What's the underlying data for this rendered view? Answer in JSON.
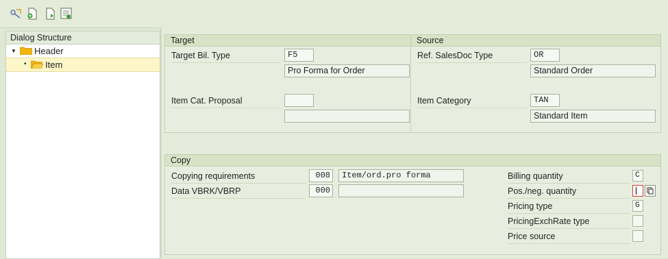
{
  "toolbar": {
    "buttons": [
      {
        "icon": "display-change-icon"
      },
      {
        "icon": "new-entries-icon"
      },
      {
        "icon": "copy-as-icon"
      },
      {
        "icon": "delimit-icon"
      }
    ]
  },
  "dialog_structure": {
    "title": "Dialog Structure",
    "items": [
      {
        "label": "Header",
        "expanded": true
      },
      {
        "label": "Item",
        "selected": true
      }
    ]
  },
  "target": {
    "title": "Target",
    "bill_type_label": "Target Bil. Type",
    "bill_type_value": "F5",
    "bill_type_desc": "Pro Forma for Order",
    "item_cat_label": "Item Cat. Proposal",
    "item_cat_value": "",
    "item_cat_desc": ""
  },
  "source": {
    "title": "Source",
    "ref_doc_label": "Ref. SalesDoc Type",
    "ref_doc_value": "OR",
    "ref_doc_desc": "Standard Order",
    "item_cat_label": "Item Category",
    "item_cat_value": "TAN",
    "item_cat_desc": "Standard Item"
  },
  "copy": {
    "title": "Copy",
    "copy_req_label": "Copying requirements",
    "copy_req_value": "008",
    "copy_req_desc": "Item/ord.pro forma",
    "data_label": "Data VBRK/VBRP",
    "data_value": "000",
    "data_desc": "",
    "billing_qty_label": "Billing quantity",
    "billing_qty_value": "C",
    "posneg_label": "Pos./neg. quantity",
    "posneg_value": "",
    "pricing_type_label": "Pricing type",
    "pricing_type_value": "G",
    "pricing_exch_label": "PricingExchRate type",
    "pricing_exch_value": "",
    "price_source_label": "Price source",
    "price_source_value": ""
  }
}
